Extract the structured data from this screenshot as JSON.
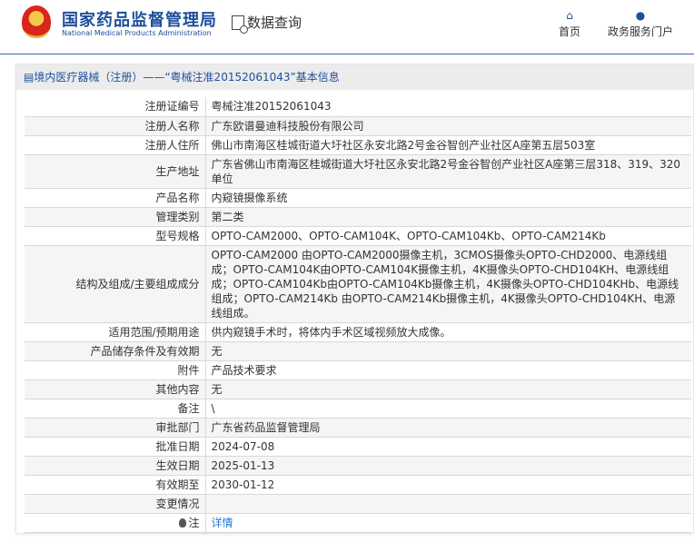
{
  "header": {
    "brand_cn": "国家药品监督管理局",
    "brand_en": "National Medical Products Administration",
    "query": "数据查询",
    "nav": [
      {
        "label": "首页",
        "icon": "home-icon"
      },
      {
        "label": "政务服务门户",
        "icon": "user-icon"
      }
    ]
  },
  "panel": {
    "title": "境内医疗器械（注册）——“粤械注准20152061043”基本信息"
  },
  "rows": [
    {
      "label": "注册证编号",
      "value": "粤械注准20152061043"
    },
    {
      "label": "注册人名称",
      "value": "广东欧谱曼迪科技股份有限公司"
    },
    {
      "label": "注册人住所",
      "value": "佛山市南海区桂城街道大圩社区永安北路2号金谷智创产业社区A座第五层503室"
    },
    {
      "label": "生产地址",
      "value": "广东省佛山市南海区桂城街道大圩社区永安北路2号金谷智创产业社区A座第三层318、319、320单位"
    },
    {
      "label": "产品名称",
      "value": "内窥镜摄像系统"
    },
    {
      "label": "管理类别",
      "value": "第二类"
    },
    {
      "label": "型号规格",
      "value": "OPTO-CAM2000、OPTO-CAM104K、OPTO-CAM104Kb、OPTO-CAM214Kb"
    },
    {
      "label": "结构及组成/主要组成成分",
      "value": "OPTO-CAM2000 由OPTO-CAM2000摄像主机，3CMOS摄像头OPTO-CHD2000、电源线组成；OPTO-CAM104K由OPTO-CAM104K摄像主机，4K摄像头OPTO-CHD104KH、电源线组成；OPTO-CAM104Kb由OPTO-CAM104Kb摄像主机，4K摄像头OPTO-CHD104KHb、电源线组成；OPTO-CAM214Kb 由OPTO-CAM214Kb摄像主机，4K摄像头OPTO-CHD104KH、电源线组成。"
    },
    {
      "label": "适用范围/预期用途",
      "value": "供内窥镜手术时，将体内手术区域视频放大成像。"
    },
    {
      "label": "产品储存条件及有效期",
      "value": "无"
    },
    {
      "label": "附件",
      "value": "产品技术要求"
    },
    {
      "label": "其他内容",
      "value": "无"
    },
    {
      "label": "备注",
      "value": "\\"
    },
    {
      "label": "审批部门",
      "value": "广东省药品监督管理局"
    },
    {
      "label": "批准日期",
      "value": "2024-07-08"
    },
    {
      "label": "生效日期",
      "value": "2025-01-13"
    },
    {
      "label": "有效期至",
      "value": "2030-01-12"
    },
    {
      "label": "变更情况",
      "value": ""
    },
    {
      "label": "注",
      "value": "详情"
    }
  ]
}
